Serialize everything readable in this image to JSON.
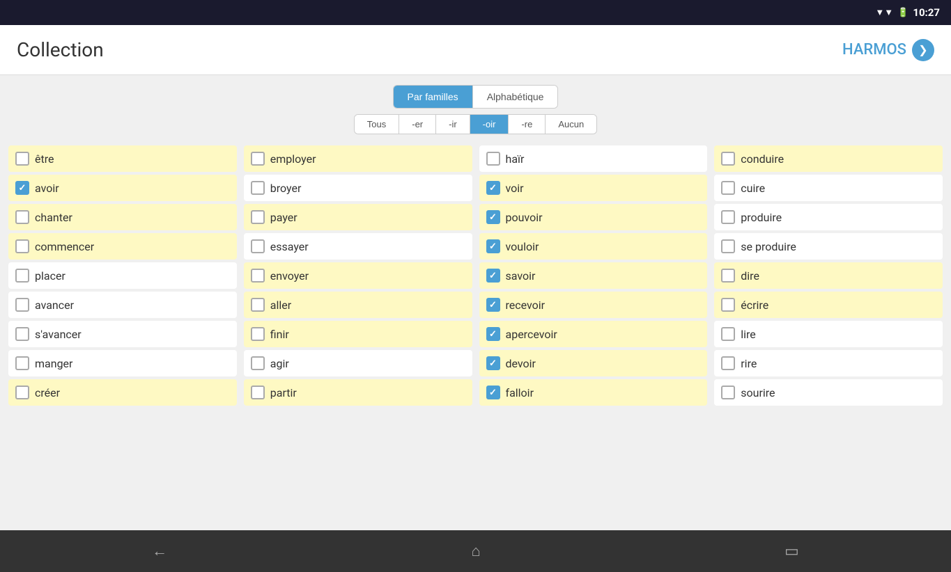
{
  "statusBar": {
    "time": "10:27",
    "wifiIcon": "▼",
    "batteryIcon": "▮"
  },
  "header": {
    "title": "Collection",
    "rightLabel": "HARMOS",
    "rightArrow": "❯"
  },
  "tabs": {
    "primary": [
      {
        "id": "par-familles",
        "label": "Par familles",
        "active": true
      },
      {
        "id": "alphabetique",
        "label": "Alphabétique",
        "active": false
      }
    ],
    "secondary": [
      {
        "id": "tous",
        "label": "Tous",
        "active": false
      },
      {
        "id": "er",
        "label": "-er",
        "active": false
      },
      {
        "id": "ir",
        "label": "-ir",
        "active": false
      },
      {
        "id": "oir",
        "label": "-oir",
        "active": true
      },
      {
        "id": "re",
        "label": "-re",
        "active": false
      },
      {
        "id": "aucun",
        "label": "Aucun",
        "active": false
      }
    ]
  },
  "columns": [
    {
      "id": "col1",
      "items": [
        {
          "label": "être",
          "checked": false,
          "yellow": true
        },
        {
          "label": "avoir",
          "checked": true,
          "yellow": true
        },
        {
          "label": "chanter",
          "checked": false,
          "yellow": true
        },
        {
          "label": "commencer",
          "checked": false,
          "yellow": true
        },
        {
          "label": "placer",
          "checked": false,
          "yellow": false
        },
        {
          "label": "avancer",
          "checked": false,
          "yellow": false
        },
        {
          "label": "s'avancer",
          "checked": false,
          "yellow": false
        },
        {
          "label": "manger",
          "checked": false,
          "yellow": false
        },
        {
          "label": "créer",
          "checked": false,
          "yellow": true
        }
      ]
    },
    {
      "id": "col2",
      "items": [
        {
          "label": "employer",
          "checked": false,
          "yellow": true
        },
        {
          "label": "broyer",
          "checked": false,
          "yellow": false
        },
        {
          "label": "payer",
          "checked": false,
          "yellow": true
        },
        {
          "label": "essayer",
          "checked": false,
          "yellow": false
        },
        {
          "label": "envoyer",
          "checked": false,
          "yellow": true
        },
        {
          "label": "aller",
          "checked": false,
          "yellow": true
        },
        {
          "label": "finir",
          "checked": false,
          "yellow": true
        },
        {
          "label": "agir",
          "checked": false,
          "yellow": false
        },
        {
          "label": "partir",
          "checked": false,
          "yellow": true
        }
      ]
    },
    {
      "id": "col3",
      "items": [
        {
          "label": "haïr",
          "checked": false,
          "yellow": false
        },
        {
          "label": "voir",
          "checked": true,
          "yellow": true
        },
        {
          "label": "pouvoir",
          "checked": true,
          "yellow": true
        },
        {
          "label": "vouloir",
          "checked": true,
          "yellow": true
        },
        {
          "label": "savoir",
          "checked": true,
          "yellow": true
        },
        {
          "label": "recevoir",
          "checked": true,
          "yellow": true
        },
        {
          "label": "apercevoir",
          "checked": true,
          "yellow": true
        },
        {
          "label": "devoir",
          "checked": true,
          "yellow": true
        },
        {
          "label": "falloir",
          "checked": true,
          "yellow": true
        }
      ]
    },
    {
      "id": "col4",
      "items": [
        {
          "label": "conduire",
          "checked": false,
          "yellow": true
        },
        {
          "label": "cuire",
          "checked": false,
          "yellow": false
        },
        {
          "label": "produire",
          "checked": false,
          "yellow": false
        },
        {
          "label": "se produire",
          "checked": false,
          "yellow": false
        },
        {
          "label": "dire",
          "checked": false,
          "yellow": true
        },
        {
          "label": "écrire",
          "checked": false,
          "yellow": true
        },
        {
          "label": "lire",
          "checked": false,
          "yellow": false
        },
        {
          "label": "rire",
          "checked": false,
          "yellow": false
        },
        {
          "label": "sourire",
          "checked": false,
          "yellow": false
        }
      ]
    }
  ],
  "bottomNav": {
    "back": "←",
    "home": "⌂",
    "recents": "▭"
  }
}
